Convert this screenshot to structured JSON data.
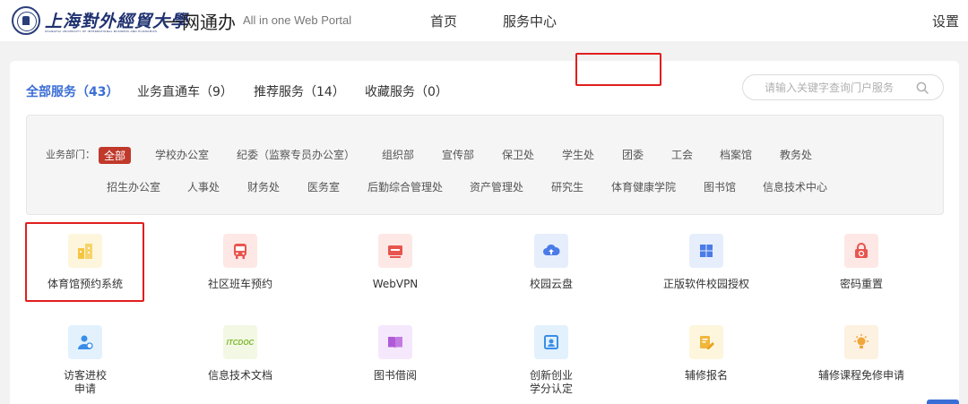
{
  "header": {
    "logo_text": "上海對外經貿大學",
    "logo_subtext": "SHANGHAI UNIVERSITY OF INTERNATIONAL BUSINESS AND ECONOMICS",
    "portal_name": "一网通办",
    "portal_en": "All in one Web Portal",
    "nav": {
      "home": "首页",
      "service_center": "服务中心",
      "settings": "设置"
    }
  },
  "tabs": {
    "all": "全部服务（43）",
    "express": "业务直通车（9）",
    "recommend": "推荐服务（14）",
    "favorites": "收藏服务（0）",
    "active": "all"
  },
  "search": {
    "placeholder": "请输入关键字查询门户服务",
    "value": ""
  },
  "departments": {
    "label": "业务部门：",
    "row1": [
      "全部",
      "学校办公室",
      "纪委（监察专员办公室）",
      "组织部",
      "宣传部",
      "保卫处",
      "学生处",
      "团委",
      "工会",
      "档案馆",
      "教务处"
    ],
    "row2": [
      "招生办公室",
      "人事处",
      "财务处",
      "医务室",
      "后勤综合管理处",
      "资产管理处",
      "研究生",
      "体育健康学院",
      "图书馆",
      "信息技术中心"
    ],
    "selected": "全部",
    "highlighted": "体育健康学院"
  },
  "services": [
    {
      "label": "体育馆预约系统",
      "icon": "building-icon",
      "color": "#f5c542",
      "bg": "#fdf6dc"
    },
    {
      "label": "社区班车预约",
      "icon": "bus-icon",
      "color": "#e8554e",
      "bg": "#fde8e6"
    },
    {
      "label": "WebVPN",
      "icon": "vpn-icon",
      "color": "#e8554e",
      "bg": "#fde8e6"
    },
    {
      "label": "校园云盘",
      "icon": "cloud-upload-icon",
      "color": "#4a7be8",
      "bg": "#e6eefc"
    },
    {
      "label": "正版软件校园授权",
      "icon": "windows-icon",
      "color": "#4a7be8",
      "bg": "#e6eefc"
    },
    {
      "label": "密码重置",
      "icon": "lock-reset-icon",
      "color": "#e8554e",
      "bg": "#fde8e6"
    },
    {
      "label": "访客进校\n申请",
      "icon": "visitor-icon",
      "color": "#3a8ee8",
      "bg": "#e3f1fd"
    },
    {
      "label": "信息技术文档",
      "icon": "itcdoc-icon",
      "color": "#7cb82f",
      "bg": "#f3f8e4",
      "icon_text": "ITCDOC"
    },
    {
      "label": "图书借阅",
      "icon": "book-icon",
      "color": "#b05ad8",
      "bg": "#f6e8fc"
    },
    {
      "label": "创新创业\n学分认定",
      "icon": "certificate-icon",
      "color": "#3a8ee8",
      "bg": "#e3f1fd"
    },
    {
      "label": "辅修报名",
      "icon": "edit-form-icon",
      "color": "#f0b73a",
      "bg": "#fdf6dc"
    },
    {
      "label": "辅修课程免修申请",
      "icon": "lightbulb-icon",
      "color": "#f0a63a",
      "bg": "#fdf1e1"
    }
  ]
}
